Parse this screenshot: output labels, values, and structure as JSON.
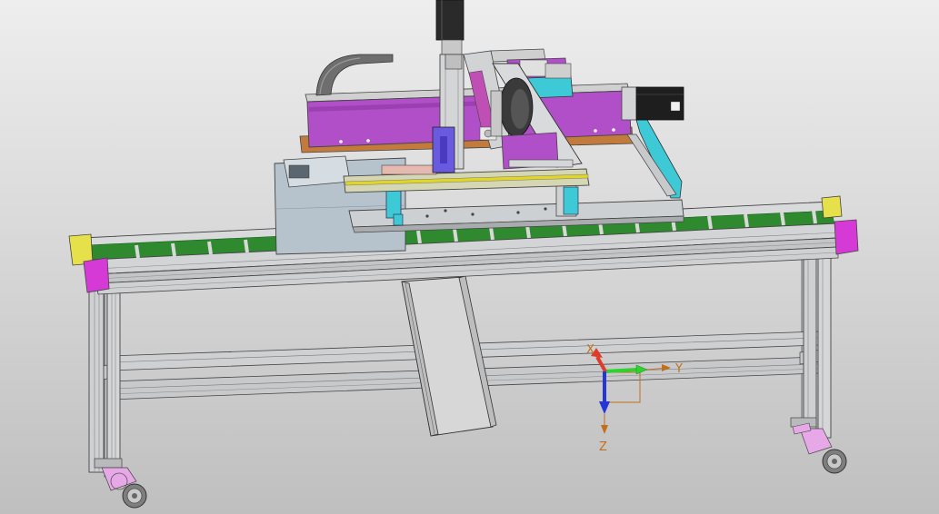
{
  "viewport": {
    "background_top": "#eeeeee",
    "background_bottom": "#bfbfbf"
  },
  "model": {
    "frame_color": "#c9cacc",
    "end_cap_color": "#d63ad6",
    "end_cap_yellow": "#e6e04a",
    "carriage_color": "#b04fc7",
    "cyan_part_color": "#3ec9d6",
    "motor_color": "#1e1e1e",
    "plate_color": "#cdd0d3",
    "cabinet_color": "#b7c3cc",
    "copper_plate_color": "#c27a3d",
    "belt_green": "#2f8a2f",
    "caster_color": "#e7a8e8",
    "chute_color": "#d2d2d2",
    "cable_carrier_color": "#6e6e6e"
  },
  "triad": {
    "x_label": "X",
    "y_label": "Y",
    "z_label": "Z",
    "x_color": "#e03a2a",
    "y_color": "#2fd22f",
    "z_color": "#2436d6",
    "label_color": "#c0701a"
  }
}
